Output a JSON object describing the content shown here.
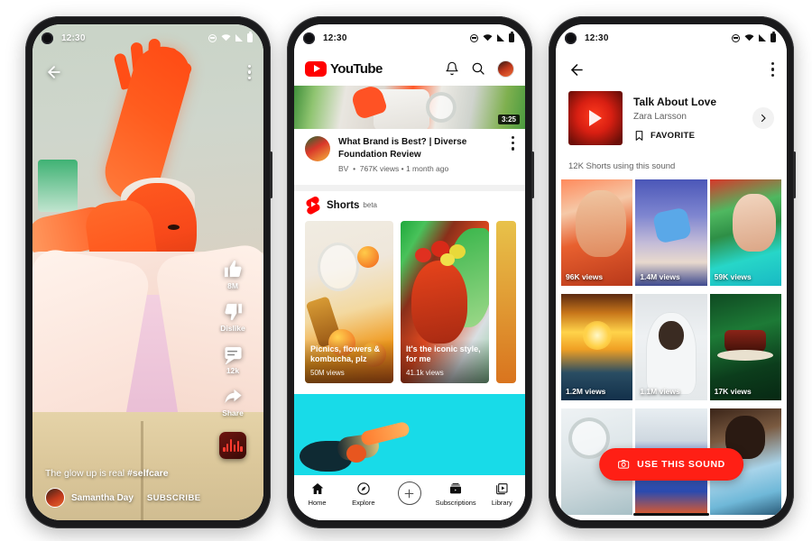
{
  "status_bar": {
    "time": "12:30",
    "icons": [
      "dnd-icon",
      "wifi-icon",
      "signal-icon",
      "battery-icon"
    ]
  },
  "phone1": {
    "name": "youtube-shorts-player",
    "back_icon": "back-arrow-icon",
    "menu_icon": "kebab-menu-icon",
    "actions": [
      {
        "icon": "thumbs-up-icon",
        "label": "8M"
      },
      {
        "icon": "thumbs-down-icon",
        "label": "Dislike"
      },
      {
        "icon": "comment-icon",
        "label": "12k"
      },
      {
        "icon": "share-icon",
        "label": "Share"
      }
    ],
    "sound_disc_icon": "sound-waveform-icon",
    "caption_plain": "The glow up is real ",
    "caption_hashtag": "#selfcare",
    "channel_name": "Samantha Day",
    "subscribe_label": "SUBSCRIBE"
  },
  "phone2": {
    "name": "youtube-home",
    "brand": "YouTube",
    "header_icons": [
      "bell-icon",
      "search-icon",
      "account-avatar"
    ],
    "featured_video": {
      "duration": "3:25",
      "title": "What Brand is Best? | Diverse Foundation Review",
      "channel": "BV",
      "views": "767K views",
      "age": "1 month ago",
      "menu_icon": "kebab-menu-icon"
    },
    "shorts_shelf": {
      "logo_icon": "shorts-logo-icon",
      "title": "Shorts",
      "badge": "beta",
      "cards": [
        {
          "title": "Picnics, flowers & kombucha, plz",
          "views": "50M views"
        },
        {
          "title": "It's the iconic style, for me",
          "views": "41.1k views"
        }
      ]
    },
    "nav": [
      {
        "icon": "home-icon",
        "label": "Home"
      },
      {
        "icon": "explore-compass-icon",
        "label": "Explore"
      },
      {
        "icon": "plus-icon",
        "label": ""
      },
      {
        "icon": "subscriptions-icon",
        "label": "Subscriptions"
      },
      {
        "icon": "library-icon",
        "label": "Library"
      }
    ]
  },
  "phone3": {
    "name": "shorts-sound-detail",
    "back_icon": "back-arrow-icon",
    "menu_icon": "kebab-menu-icon",
    "sound": {
      "artwork_icon": "play-thumbnail-icon",
      "title": "Talk About Love",
      "artist": "Zara Larsson",
      "favorite_icon": "bookmark-icon",
      "favorite_label": "FAVORITE",
      "chevron_icon": "chevron-right-icon"
    },
    "usage_count": "12K Shorts using this sound",
    "grid": [
      {
        "views": "96K views"
      },
      {
        "views": "1.4M views"
      },
      {
        "views": "59K views"
      },
      {
        "views": "1.2M views"
      },
      {
        "views": "1.1M views"
      },
      {
        "views": "17K views"
      },
      {
        "views": ""
      },
      {
        "views": ""
      },
      {
        "views": ""
      }
    ],
    "use_sound": {
      "icon": "camera-icon",
      "label": "USE THIS SOUND"
    }
  },
  "colors": {
    "youtube_red": "#ff0000",
    "use_sound_red": "#ff1f15",
    "cyan_block": "#18dbe8",
    "text_primary": "#0f0f0f",
    "text_secondary": "#606060"
  }
}
